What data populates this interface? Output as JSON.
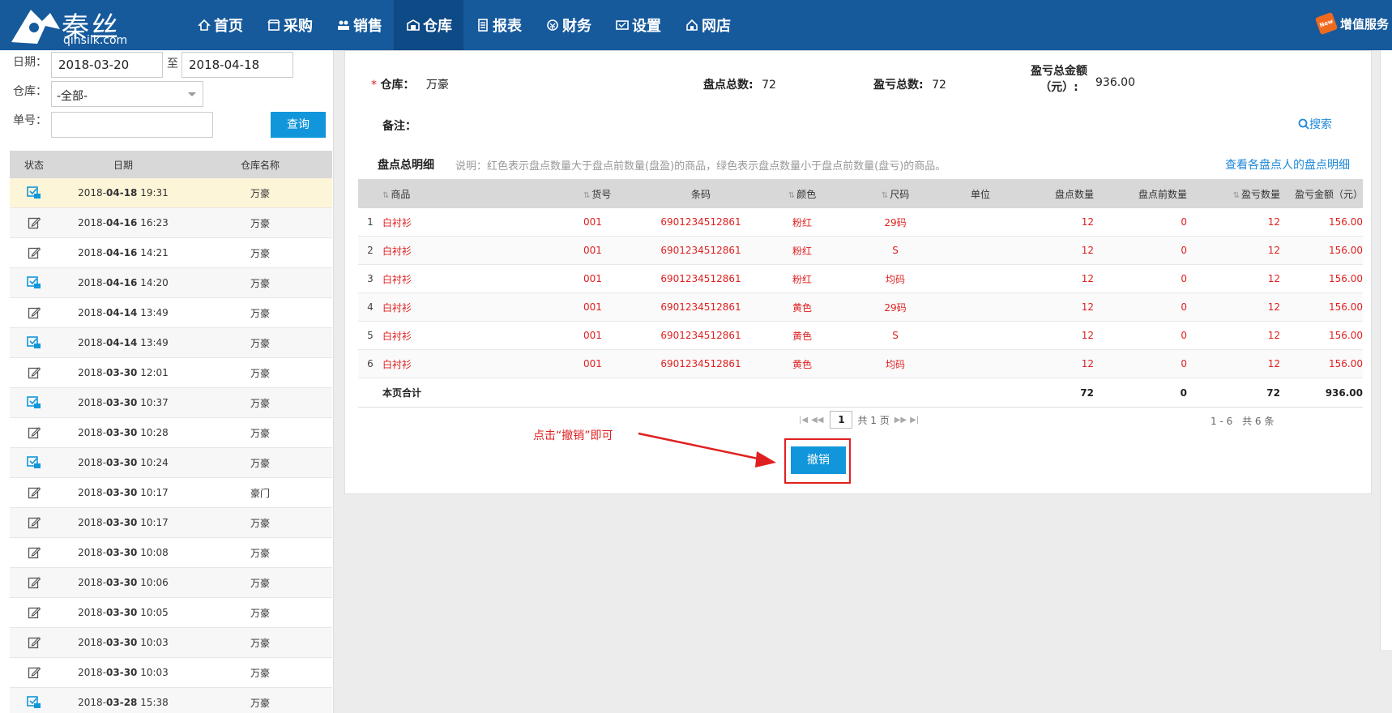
{
  "brand": {
    "name": "秦丝",
    "domain": "qinsilk.com"
  },
  "nav": [
    {
      "label": "首页",
      "icon": "home-icon"
    },
    {
      "label": "采购",
      "icon": "shop-icon"
    },
    {
      "label": "销售",
      "icon": "users-icon"
    },
    {
      "label": "仓库",
      "icon": "warehouse-icon",
      "active": true
    },
    {
      "label": "报表",
      "icon": "report-icon"
    },
    {
      "label": "财务",
      "icon": "finance-icon"
    },
    {
      "label": "设置",
      "icon": "settings-icon"
    },
    {
      "label": "网店",
      "icon": "store-icon"
    }
  ],
  "addon": {
    "label": "增值服务",
    "badge": "New"
  },
  "filters": {
    "date_label": "日期：",
    "date_from": "2018-03-20",
    "to_label": "至",
    "date_to": "2018-04-18",
    "warehouse_label": "仓库：",
    "warehouse_value": "-全部-",
    "number_label": "单号：",
    "number_value": "",
    "query_label": "查询"
  },
  "list": {
    "headers": {
      "status": "状态",
      "date": "日期",
      "warehouse": "仓库名称"
    },
    "rows": [
      {
        "status": "done",
        "date_pre": "2018-",
        "date_md": "04-18",
        "time": " 19:31",
        "warehouse": "万豪"
      },
      {
        "status": "edit",
        "date_pre": "2018-",
        "date_md": "04-16",
        "time": " 16:23",
        "warehouse": "万豪"
      },
      {
        "status": "edit",
        "date_pre": "2018-",
        "date_md": "04-16",
        "time": " 14:21",
        "warehouse": "万豪"
      },
      {
        "status": "done",
        "date_pre": "2018-",
        "date_md": "04-16",
        "time": " 14:20",
        "warehouse": "万豪"
      },
      {
        "status": "edit",
        "date_pre": "2018-",
        "date_md": "04-14",
        "time": " 13:49",
        "warehouse": "万豪"
      },
      {
        "status": "done",
        "date_pre": "2018-",
        "date_md": "04-14",
        "time": " 13:49",
        "warehouse": "万豪"
      },
      {
        "status": "edit",
        "date_pre": "2018-",
        "date_md": "03-30",
        "time": " 12:01",
        "warehouse": "万豪"
      },
      {
        "status": "done",
        "date_pre": "2018-",
        "date_md": "03-30",
        "time": " 10:37",
        "warehouse": "万豪"
      },
      {
        "status": "edit",
        "date_pre": "2018-",
        "date_md": "03-30",
        "time": " 10:28",
        "warehouse": "万豪"
      },
      {
        "status": "done",
        "date_pre": "2018-",
        "date_md": "03-30",
        "time": " 10:24",
        "warehouse": "万豪"
      },
      {
        "status": "edit",
        "date_pre": "2018-",
        "date_md": "03-30",
        "time": " 10:17",
        "warehouse": "豪门"
      },
      {
        "status": "edit",
        "date_pre": "2018-",
        "date_md": "03-30",
        "time": " 10:17",
        "warehouse": "万豪"
      },
      {
        "status": "edit",
        "date_pre": "2018-",
        "date_md": "03-30",
        "time": " 10:08",
        "warehouse": "万豪"
      },
      {
        "status": "edit",
        "date_pre": "2018-",
        "date_md": "03-30",
        "time": " 10:06",
        "warehouse": "万豪"
      },
      {
        "status": "edit",
        "date_pre": "2018-",
        "date_md": "03-30",
        "time": " 10:05",
        "warehouse": "万豪"
      },
      {
        "status": "edit",
        "date_pre": "2018-",
        "date_md": "03-30",
        "time": " 10:03",
        "warehouse": "万豪"
      },
      {
        "status": "edit",
        "date_pre": "2018-",
        "date_md": "03-30",
        "time": " 10:03",
        "warehouse": "万豪"
      },
      {
        "status": "done",
        "date_pre": "2018-",
        "date_md": "03-28",
        "time": " 15:38",
        "warehouse": "万豪"
      }
    ]
  },
  "detail": {
    "warehouse_label": "仓库：",
    "warehouse_value": "万豪",
    "total_count_label": "盘点总数:",
    "total_count_value": "72",
    "pl_count_label": "盈亏总数:",
    "pl_count_value": "72",
    "pl_amount_label_1": "盈亏总金额",
    "pl_amount_label_2": "（元）:",
    "pl_amount_value": "936.00",
    "remark_label": "备注：",
    "search_label": "搜索",
    "section_title": "盘点总明细",
    "section_desc": "说明：红色表示盘点数量大于盘点前数量(盘盈)的商品，绿色表示盘点数量小于盘点前数量(盘亏)的商品。",
    "section_link": "查看各盘点人的盘点明细"
  },
  "table": {
    "headers": {
      "product": "商品",
      "code": "货号",
      "barcode": "条码",
      "color": "颜色",
      "size": "尺码",
      "unit": "单位",
      "qty": "盘点数量",
      "pre": "盘点前数量",
      "pl": "盈亏数量",
      "amount": "盈亏金额（元）"
    },
    "rows": [
      {
        "no": "1",
        "product": "白衬衫",
        "code": "001",
        "barcode": "6901234512861",
        "color": "粉红",
        "size": "29码",
        "unit": "",
        "qty": "12",
        "pre": "0",
        "pl": "12",
        "amount": "156.00"
      },
      {
        "no": "2",
        "product": "白衬衫",
        "code": "001",
        "barcode": "6901234512861",
        "color": "粉红",
        "size": "S",
        "unit": "",
        "qty": "12",
        "pre": "0",
        "pl": "12",
        "amount": "156.00"
      },
      {
        "no": "3",
        "product": "白衬衫",
        "code": "001",
        "barcode": "6901234512861",
        "color": "粉红",
        "size": "均码",
        "unit": "",
        "qty": "12",
        "pre": "0",
        "pl": "12",
        "amount": "156.00"
      },
      {
        "no": "4",
        "product": "白衬衫",
        "code": "001",
        "barcode": "6901234512861",
        "color": "黄色",
        "size": "29码",
        "unit": "",
        "qty": "12",
        "pre": "0",
        "pl": "12",
        "amount": "156.00"
      },
      {
        "no": "5",
        "product": "白衬衫",
        "code": "001",
        "barcode": "6901234512861",
        "color": "黄色",
        "size": "S",
        "unit": "",
        "qty": "12",
        "pre": "0",
        "pl": "12",
        "amount": "156.00"
      },
      {
        "no": "6",
        "product": "白衬衫",
        "code": "001",
        "barcode": "6901234512861",
        "color": "黄色",
        "size": "均码",
        "unit": "",
        "qty": "12",
        "pre": "0",
        "pl": "12",
        "amount": "156.00"
      }
    ],
    "footer": {
      "label": "本页合计",
      "qty": "72",
      "pre": "0",
      "pl": "72",
      "amount": "936.00"
    }
  },
  "pager": {
    "page": "1",
    "total_pages": "共 1 页",
    "range": "1 - 6",
    "total": "共 6 条"
  },
  "annotation": {
    "hint": "点击“撤销”即可"
  },
  "cancel_label": "撤销",
  "colors": {
    "topbar": "#165a9c",
    "accent": "#1296db",
    "red": "#e02020",
    "link": "#1e88d8"
  }
}
